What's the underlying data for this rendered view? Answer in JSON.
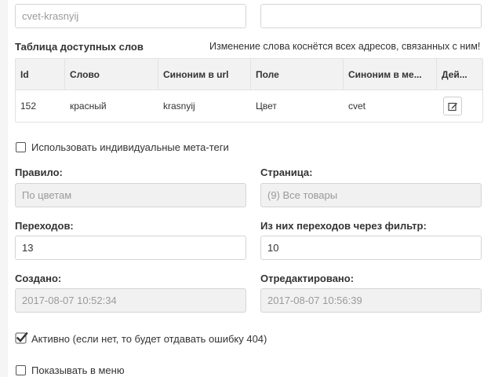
{
  "form": {
    "url_value": "cvet-krasnyij",
    "second_field_value": "",
    "table_title": "Таблица доступных слов",
    "table_notice": "Изменение слова коснётся всех адресов, связанных с ним!",
    "table": {
      "columns": [
        "Id",
        "Слово",
        "Синоним в url",
        "Поле",
        "Синоним в ме...",
        "Дей..."
      ],
      "rows": [
        {
          "id": "152",
          "word": "красный",
          "url_synonym": "krasnyij",
          "field": "Цвет",
          "meta_synonym": "cvet"
        }
      ]
    },
    "meta_checkbox_label": "Использовать индивидуальные мета-теги",
    "meta_checked": false,
    "rule_label": "Правило:",
    "rule_value": "По цветам",
    "page_label": "Страница:",
    "page_value": "(9) Все товары",
    "visits_label": "Переходов:",
    "visits_value": "13",
    "filter_visits_label": "Из них переходов через фильтр:",
    "filter_visits_value": "10",
    "created_label": "Создано:",
    "created_value": "2017-08-07 10:52:34",
    "edited_label": "Отредактировано:",
    "edited_value": "2017-08-07 10:56:39",
    "active_label": "Активно (если нет, то будет отдавать ошибку 404)",
    "active_checked": true,
    "menu_label": "Показывать в меню",
    "menu_checked": false
  }
}
